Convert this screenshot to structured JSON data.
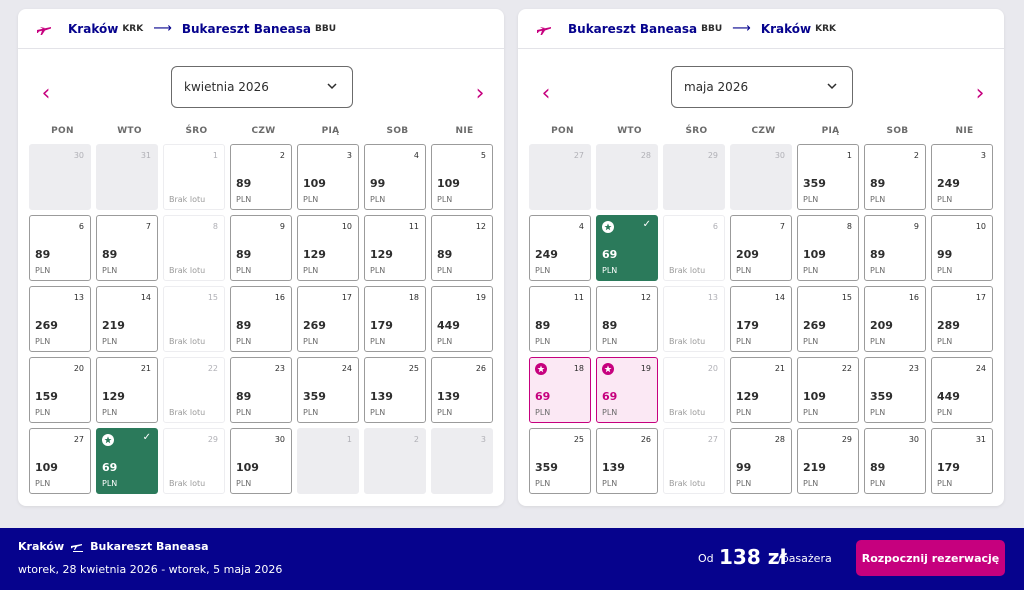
{
  "outbound": {
    "origin": "Kraków",
    "origin_code": "KRK",
    "destination": "Bukareszt Baneasa",
    "destination_code": "BBU",
    "month": "kwietnia 2026",
    "days": [
      {
        "d": "30",
        "s": "gray"
      },
      {
        "d": "31",
        "s": "gray"
      },
      {
        "d": "1",
        "s": "nofly"
      },
      {
        "d": "2",
        "p": "89"
      },
      {
        "d": "3",
        "p": "109"
      },
      {
        "d": "4",
        "p": "99"
      },
      {
        "d": "5",
        "p": "109"
      },
      {
        "d": "6",
        "p": "89"
      },
      {
        "d": "7",
        "p": "89"
      },
      {
        "d": "8",
        "s": "nofly"
      },
      {
        "d": "9",
        "p": "89"
      },
      {
        "d": "10",
        "p": "129"
      },
      {
        "d": "11",
        "p": "129"
      },
      {
        "d": "12",
        "p": "89"
      },
      {
        "d": "13",
        "p": "269"
      },
      {
        "d": "14",
        "p": "219"
      },
      {
        "d": "15",
        "s": "nofly"
      },
      {
        "d": "16",
        "p": "89"
      },
      {
        "d": "17",
        "p": "269"
      },
      {
        "d": "18",
        "p": "179"
      },
      {
        "d": "19",
        "p": "449"
      },
      {
        "d": "20",
        "p": "159"
      },
      {
        "d": "21",
        "p": "129"
      },
      {
        "d": "22",
        "s": "nofly"
      },
      {
        "d": "23",
        "p": "89"
      },
      {
        "d": "24",
        "p": "359"
      },
      {
        "d": "25",
        "p": "139"
      },
      {
        "d": "26",
        "p": "139"
      },
      {
        "d": "27",
        "p": "109"
      },
      {
        "d": "28",
        "p": "69",
        "s": "selected"
      },
      {
        "d": "29",
        "s": "nofly"
      },
      {
        "d": "30",
        "p": "109"
      },
      {
        "d": "1",
        "s": "gray"
      },
      {
        "d": "2",
        "s": "gray"
      },
      {
        "d": "3",
        "s": "gray"
      }
    ]
  },
  "return": {
    "origin": "Bukareszt Baneasa",
    "origin_code": "BBU",
    "destination": "Kraków",
    "destination_code": "KRK",
    "month": "maja 2026",
    "days": [
      {
        "d": "27",
        "s": "gray"
      },
      {
        "d": "28",
        "s": "gray"
      },
      {
        "d": "29",
        "s": "gray"
      },
      {
        "d": "30",
        "s": "gray"
      },
      {
        "d": "1",
        "p": "359"
      },
      {
        "d": "2",
        "p": "89"
      },
      {
        "d": "3",
        "p": "249"
      },
      {
        "d": "4",
        "p": "249"
      },
      {
        "d": "5",
        "p": "69",
        "s": "selected"
      },
      {
        "d": "6",
        "s": "nofly"
      },
      {
        "d": "7",
        "p": "209"
      },
      {
        "d": "8",
        "p": "109"
      },
      {
        "d": "9",
        "p": "89"
      },
      {
        "d": "10",
        "p": "99"
      },
      {
        "d": "11",
        "p": "89"
      },
      {
        "d": "12",
        "p": "89"
      },
      {
        "d": "13",
        "s": "nofly"
      },
      {
        "d": "14",
        "p": "179"
      },
      {
        "d": "15",
        "p": "269"
      },
      {
        "d": "16",
        "p": "209"
      },
      {
        "d": "17",
        "p": "289"
      },
      {
        "d": "18",
        "p": "69",
        "s": "promo"
      },
      {
        "d": "19",
        "p": "69",
        "s": "promo"
      },
      {
        "d": "20",
        "s": "nofly"
      },
      {
        "d": "21",
        "p": "129"
      },
      {
        "d": "22",
        "p": "109"
      },
      {
        "d": "23",
        "p": "359"
      },
      {
        "d": "24",
        "p": "449"
      },
      {
        "d": "25",
        "p": "359"
      },
      {
        "d": "26",
        "p": "139"
      },
      {
        "d": "27",
        "s": "nofly"
      },
      {
        "d": "28",
        "p": "99"
      },
      {
        "d": "29",
        "p": "219"
      },
      {
        "d": "30",
        "p": "89"
      },
      {
        "d": "31",
        "p": "179"
      }
    ]
  },
  "weekdays": [
    "PON",
    "WTO",
    "ŚRO",
    "CZW",
    "PIĄ",
    "SOB",
    "NIE"
  ],
  "currency": "PLN",
  "no_flight_label": "Brak lotu",
  "footer": {
    "origin": "Kraków",
    "destination": "Bukareszt Baneasa",
    "dates": "wtorek, 28 kwietnia 2026 - wtorek, 5 maja 2026",
    "from_label": "Od",
    "price": "138 zł",
    "per_passenger": "/pasażera",
    "cta_label": "Rozpocznij rezerwację"
  },
  "colors": {
    "brand_navy": "#06038d",
    "brand_pink": "#c6007e",
    "selected_green": "#2b7a5b"
  }
}
